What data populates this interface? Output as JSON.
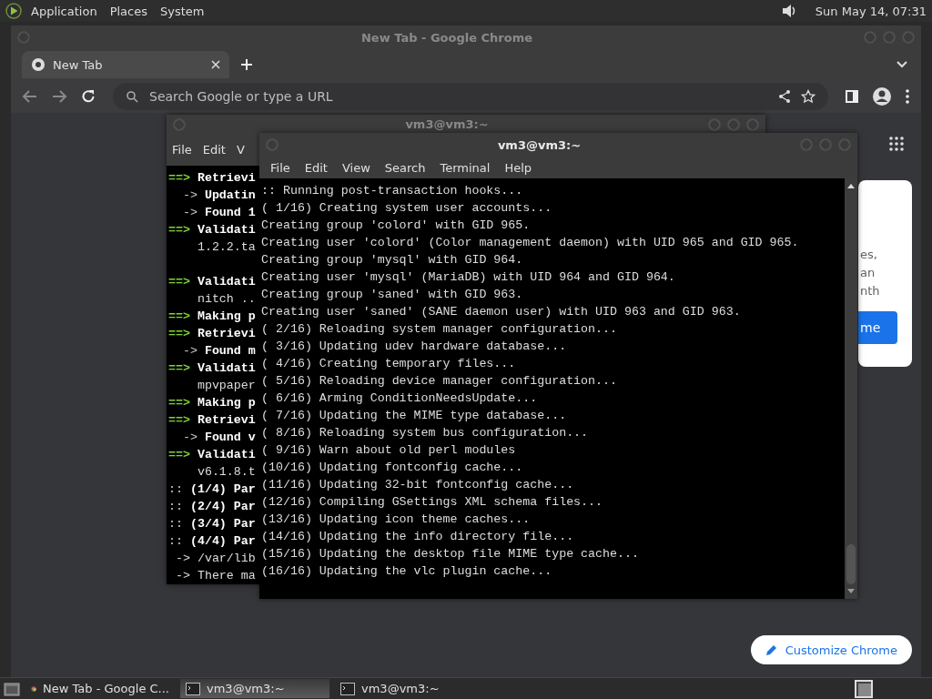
{
  "top_panel": {
    "menus": [
      "Application",
      "Places",
      "System"
    ],
    "clock": "Sun May 14, 07:31"
  },
  "browser": {
    "title": "New Tab - Google Chrome",
    "tabs": [
      {
        "label": "New Tab",
        "selected": true
      }
    ],
    "address": {
      "placeholder": "Search Google or type a URL"
    },
    "card": {
      "lines": [
        "es,",
        "an",
        "nth"
      ],
      "button": "me"
    },
    "customize_button": "Customize Chrome"
  },
  "back_terminal": {
    "title": "vm3@vm3:~",
    "menus": [
      "File",
      "Edit",
      "V"
    ],
    "lines": [
      {
        "kind": "head",
        "marker": "==>",
        "text": "Retrievi"
      },
      {
        "kind": "sub",
        "marker": "  ->",
        "text": "Updatin"
      },
      {
        "kind": "sub",
        "marker": "  ->",
        "text": "Found 1"
      },
      {
        "kind": "head",
        "marker": "==>",
        "text": "Validati"
      },
      {
        "kind": "plain",
        "text": "    1.2.2.ta"
      },
      {
        "kind": "blank"
      },
      {
        "kind": "head",
        "marker": "==>",
        "text": "Validati"
      },
      {
        "kind": "plain",
        "text": "    nitch .."
      },
      {
        "kind": "head",
        "marker": "==>",
        "text": "Making p"
      },
      {
        "kind": "head",
        "marker": "==>",
        "text": "Retrievi"
      },
      {
        "kind": "sub",
        "marker": "  ->",
        "text": "Found m"
      },
      {
        "kind": "head",
        "marker": "==>",
        "text": "Validati"
      },
      {
        "kind": "plain",
        "text": "    mpvpaper"
      },
      {
        "kind": "head",
        "marker": "==>",
        "text": "Making p"
      },
      {
        "kind": "head",
        "marker": "==>",
        "text": "Retrievi"
      },
      {
        "kind": "sub",
        "marker": "  ->",
        "text": "Found v"
      },
      {
        "kind": "head",
        "marker": "==>",
        "text": "Validati"
      },
      {
        "kind": "plain",
        "text": "    v6.1.8.t"
      },
      {
        "kind": "step",
        "marker": "::",
        "text": "(1/4) Par"
      },
      {
        "kind": "step",
        "marker": "::",
        "text": "(2/4) Par"
      },
      {
        "kind": "step",
        "marker": "::",
        "text": "(3/4) Par"
      },
      {
        "kind": "step",
        "marker": "::",
        "text": "(4/4) Par"
      },
      {
        "kind": "plain",
        "text": " -> /var/lib"
      },
      {
        "kind": "plain",
        "text": " -> There ma"
      }
    ]
  },
  "terminal": {
    "title": "vm3@vm3:~",
    "menus": [
      "File",
      "Edit",
      "View",
      "Search",
      "Terminal",
      "Help"
    ],
    "lines": [
      ":: Running post-transaction hooks...",
      "( 1/16) Creating system user accounts...",
      "Creating group 'colord' with GID 965.",
      "Creating user 'colord' (Color management daemon) with UID 965 and GID 965.",
      "Creating group 'mysql' with GID 964.",
      "Creating user 'mysql' (MariaDB) with UID 964 and GID 964.",
      "Creating group 'saned' with GID 963.",
      "Creating user 'saned' (SANE daemon user) with UID 963 and GID 963.",
      "( 2/16) Reloading system manager configuration...",
      "( 3/16) Updating udev hardware database...",
      "( 4/16) Creating temporary files...",
      "( 5/16) Reloading device manager configuration...",
      "( 6/16) Arming ConditionNeedsUpdate...",
      "( 7/16) Updating the MIME type database...",
      "( 8/16) Reloading system bus configuration...",
      "( 9/16) Warn about old perl modules",
      "(10/16) Updating fontconfig cache...",
      "(11/16) Updating 32-bit fontconfig cache...",
      "(12/16) Compiling GSettings XML schema files...",
      "(13/16) Updating icon theme caches...",
      "(14/16) Updating the info directory file...",
      "(15/16) Updating the desktop file MIME type cache...",
      "(16/16) Updating the vlc plugin cache..."
    ]
  },
  "taskbar": {
    "items": [
      {
        "kind": "browser",
        "label": "New Tab - Google C...",
        "selected": false
      },
      {
        "kind": "terminal",
        "label": "vm3@vm3:~",
        "selected": true
      },
      {
        "kind": "terminal",
        "label": "vm3@vm3:~",
        "selected": false
      }
    ]
  }
}
